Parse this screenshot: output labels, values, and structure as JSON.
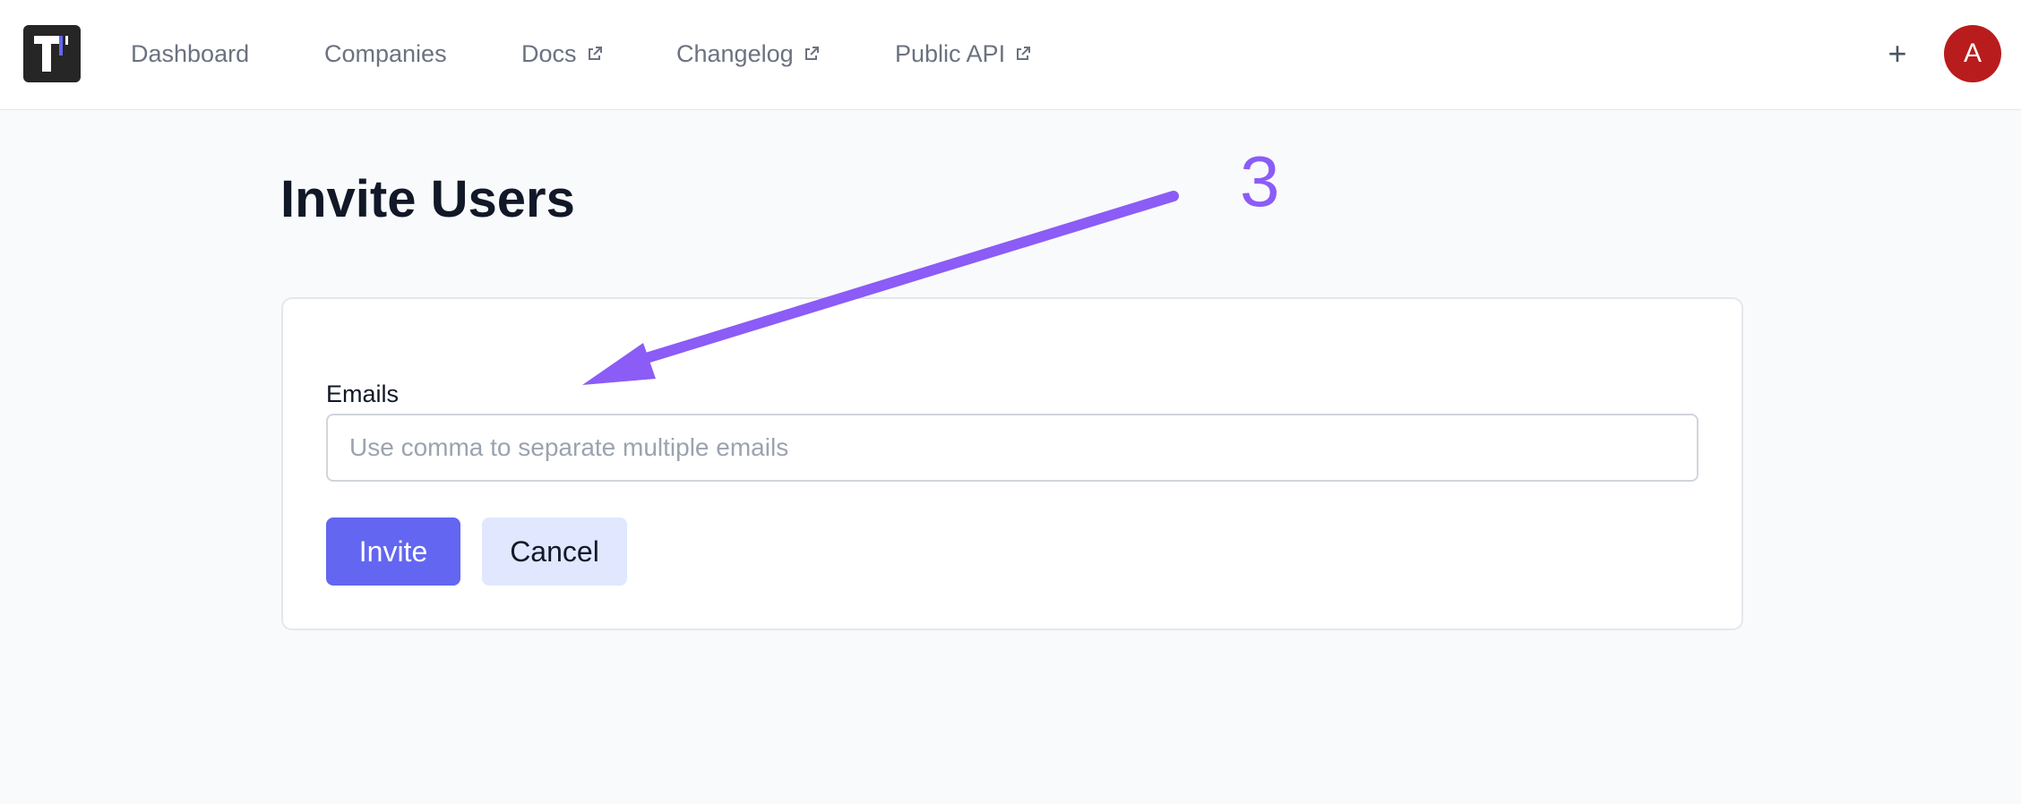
{
  "nav": {
    "logo_icon": "app-logo",
    "items": [
      {
        "label": "Dashboard",
        "external": false
      },
      {
        "label": "Companies",
        "external": false
      },
      {
        "label": "Docs",
        "external": true
      },
      {
        "label": "Changelog",
        "external": true
      },
      {
        "label": "Public API",
        "external": true
      }
    ],
    "plus_label": "+",
    "avatar_initial": "A",
    "avatar_color": "#b91c1c"
  },
  "page": {
    "title": "Invite Users"
  },
  "form": {
    "emails_label": "Emails",
    "emails_value": "",
    "emails_placeholder": "Use comma to separate multiple emails",
    "invite_label": "Invite",
    "cancel_label": "Cancel"
  },
  "annotation": {
    "step_number": "3",
    "color": "#8b5cf6"
  },
  "colors": {
    "primary": "#6366f1",
    "secondary": "#e0e7ff",
    "background": "#f9fafb"
  }
}
